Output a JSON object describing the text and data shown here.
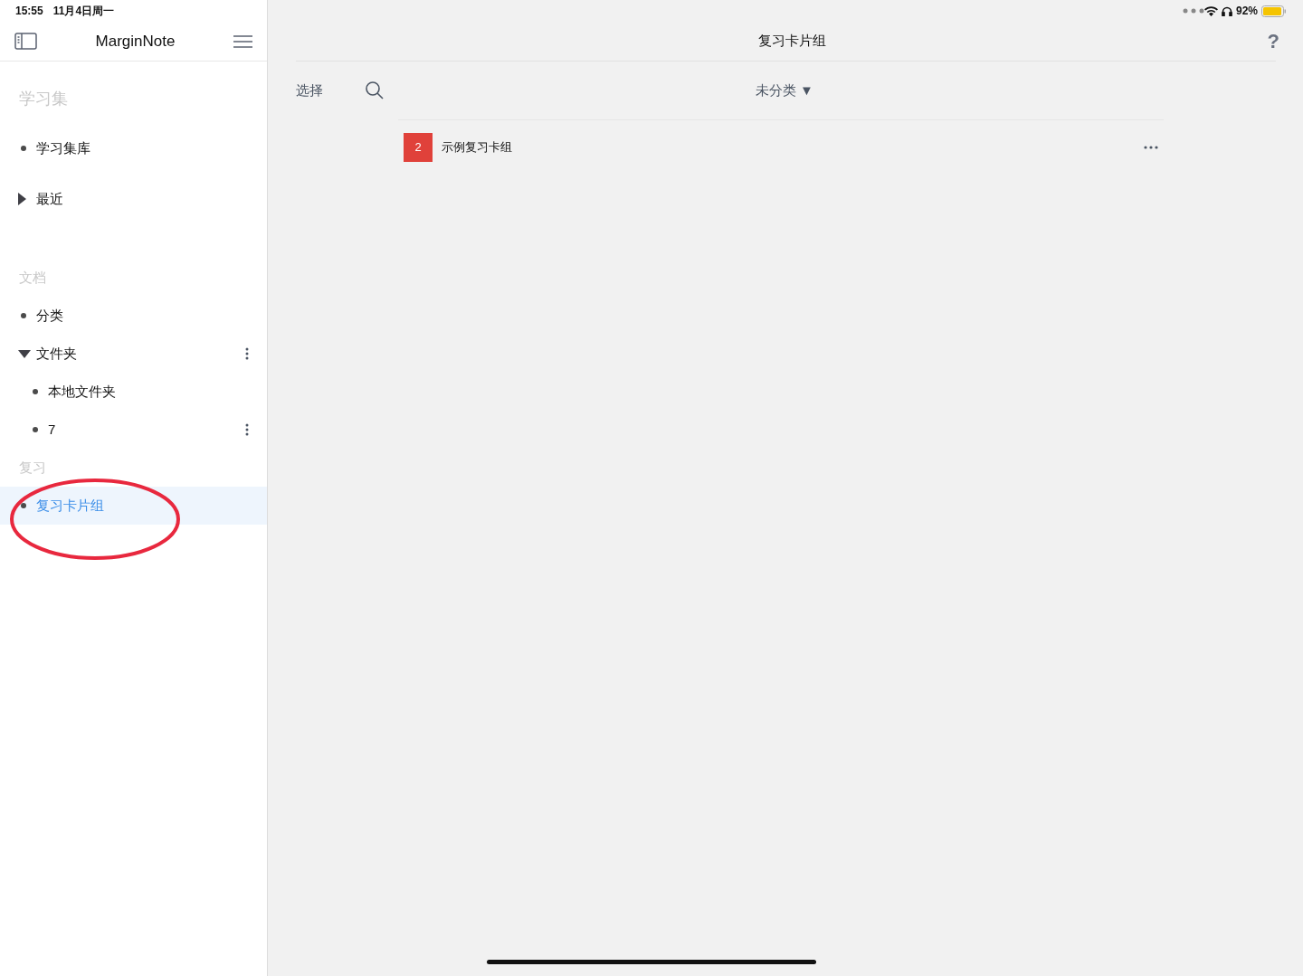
{
  "status_bar": {
    "time": "15:55",
    "date": "11月4日周一",
    "battery": "92%"
  },
  "sidebar": {
    "title": "MarginNote",
    "sections": [
      {
        "header": "学习集",
        "items": [
          {
            "label": "学习集库",
            "kind": "bullet",
            "selected": false,
            "has_menu": false
          },
          {
            "label": "最近",
            "kind": "expander",
            "expanded": false,
            "selected": false,
            "has_menu": false
          }
        ]
      },
      {
        "header": "文档",
        "items": [
          {
            "label": "分类",
            "kind": "bullet",
            "selected": false,
            "has_menu": false
          },
          {
            "label": "文件夹",
            "kind": "expander",
            "expanded": true,
            "selected": false,
            "has_menu": true,
            "children": [
              {
                "label": "本地文件夹",
                "kind": "bullet",
                "selected": false,
                "has_menu": false
              },
              {
                "label": "7",
                "kind": "bullet",
                "selected": false,
                "has_menu": true
              }
            ]
          }
        ]
      },
      {
        "header": "复习",
        "items": [
          {
            "label": "复习卡片组",
            "kind": "bullet",
            "selected": true,
            "has_menu": false
          }
        ]
      }
    ]
  },
  "main": {
    "title": "复习卡片组",
    "select_label": "选择",
    "filter": {
      "label": "未分类",
      "caret": "▼"
    },
    "help": "?",
    "decks": [
      {
        "count": "2",
        "name": "示例复习卡组"
      }
    ]
  }
}
